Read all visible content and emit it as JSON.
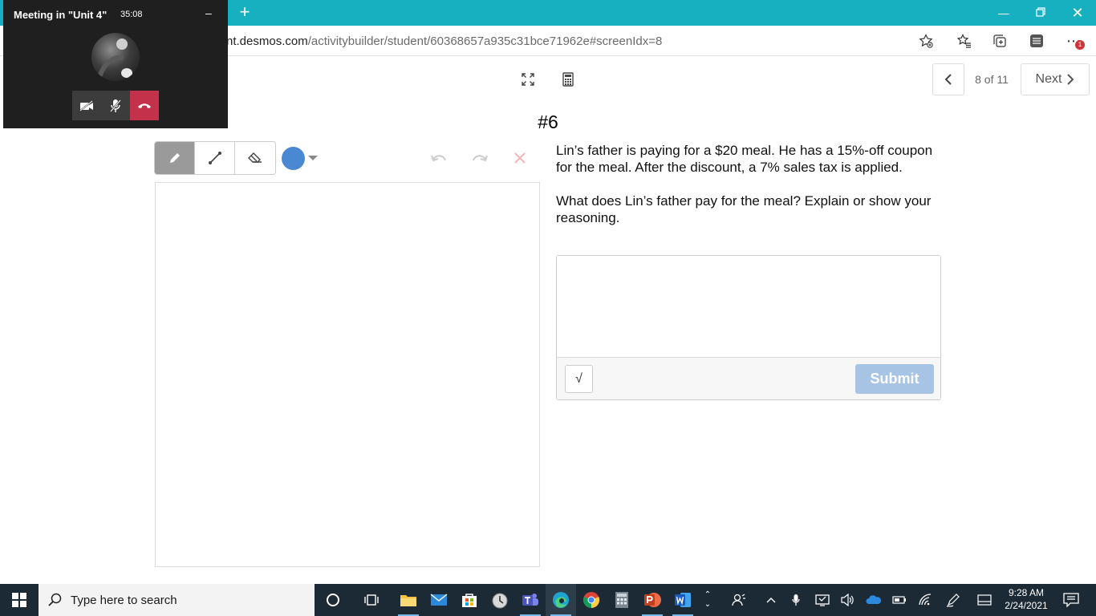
{
  "browser": {
    "url_domain": "nt.desmos.com",
    "url_path": "/activitybuilder/student/60368657a935c31bce71962e#screenIdx=8",
    "notification_count": "1"
  },
  "toolbar": {
    "page_indicator": "8 of 11",
    "next_label": "Next"
  },
  "screen": {
    "title": "#6"
  },
  "question": {
    "paragraph1": "Lin’s father is paying for a $20 meal. He has a 15%-off coupon for the meal. After the discount, a 7% sales tax is applied.",
    "paragraph2": "What does Lin’s father pay for the meal? Explain or show your reasoning.",
    "answer_value": "",
    "math_button_symbol": "√",
    "submit_label": "Submit"
  },
  "sketch": {
    "pen_color": "#4a88d3"
  },
  "meeting": {
    "title": "Meeting in \"Unit 4\"",
    "elapsed": "35:08"
  },
  "taskbar": {
    "search_placeholder": "Type here to search",
    "time": "9:28 AM",
    "date": "2/24/2021"
  },
  "colors": {
    "tab_bar": "#17b0c1",
    "submit_disabled": "#a8c4e4",
    "hangup": "#c4314b",
    "taskbar": "#1c2a36"
  }
}
